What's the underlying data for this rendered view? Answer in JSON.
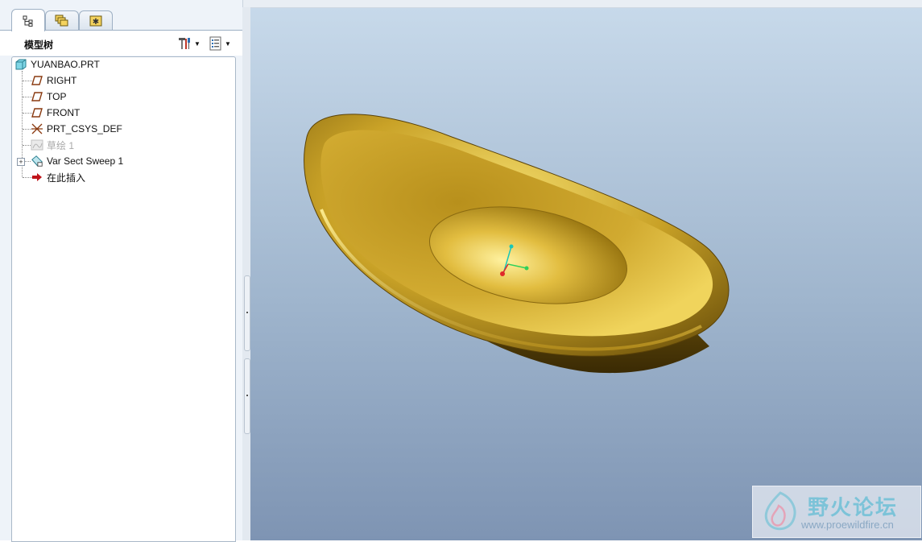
{
  "tabs": [
    {
      "name": "model-tree",
      "icon": "model-tree-icon",
      "active": true
    },
    {
      "name": "layers",
      "icon": "layers-icon",
      "active": false
    },
    {
      "name": "favorites",
      "icon": "favorites-icon",
      "active": false
    }
  ],
  "panel": {
    "title": "模型树",
    "settings_icon": "settings-tools-icon",
    "show_icon": "show-list-icon"
  },
  "tree": {
    "root": {
      "label": "YUANBAO.PRT",
      "icon": "part-icon"
    },
    "items": [
      {
        "label": "RIGHT",
        "icon": "datum-plane-icon",
        "dim": false
      },
      {
        "label": "TOP",
        "icon": "datum-plane-icon",
        "dim": false
      },
      {
        "label": "FRONT",
        "icon": "datum-plane-icon",
        "dim": false
      },
      {
        "label": "PRT_CSYS_DEF",
        "icon": "coordinate-system-icon",
        "dim": false
      },
      {
        "label": "草绘 1",
        "icon": "sketch-icon",
        "dim": true
      },
      {
        "label": "Var Sect Sweep 1",
        "icon": "sweep-feature-icon",
        "dim": false,
        "expandable": true
      },
      {
        "label": "在此插入",
        "icon": "insert-here-arrow-icon",
        "dim": false
      }
    ]
  },
  "graphics": {
    "model": "yuanbao-gold-ingot",
    "colors": {
      "gold": "#c9a227",
      "gold_dark": "#8a6a10",
      "gold_light": "#f3dc6a",
      "background_top": "#c7d9ea",
      "background_bottom": "#7e94b3"
    }
  },
  "watermark": {
    "title": "野火论坛",
    "url": "www.proewildfire.cn"
  }
}
